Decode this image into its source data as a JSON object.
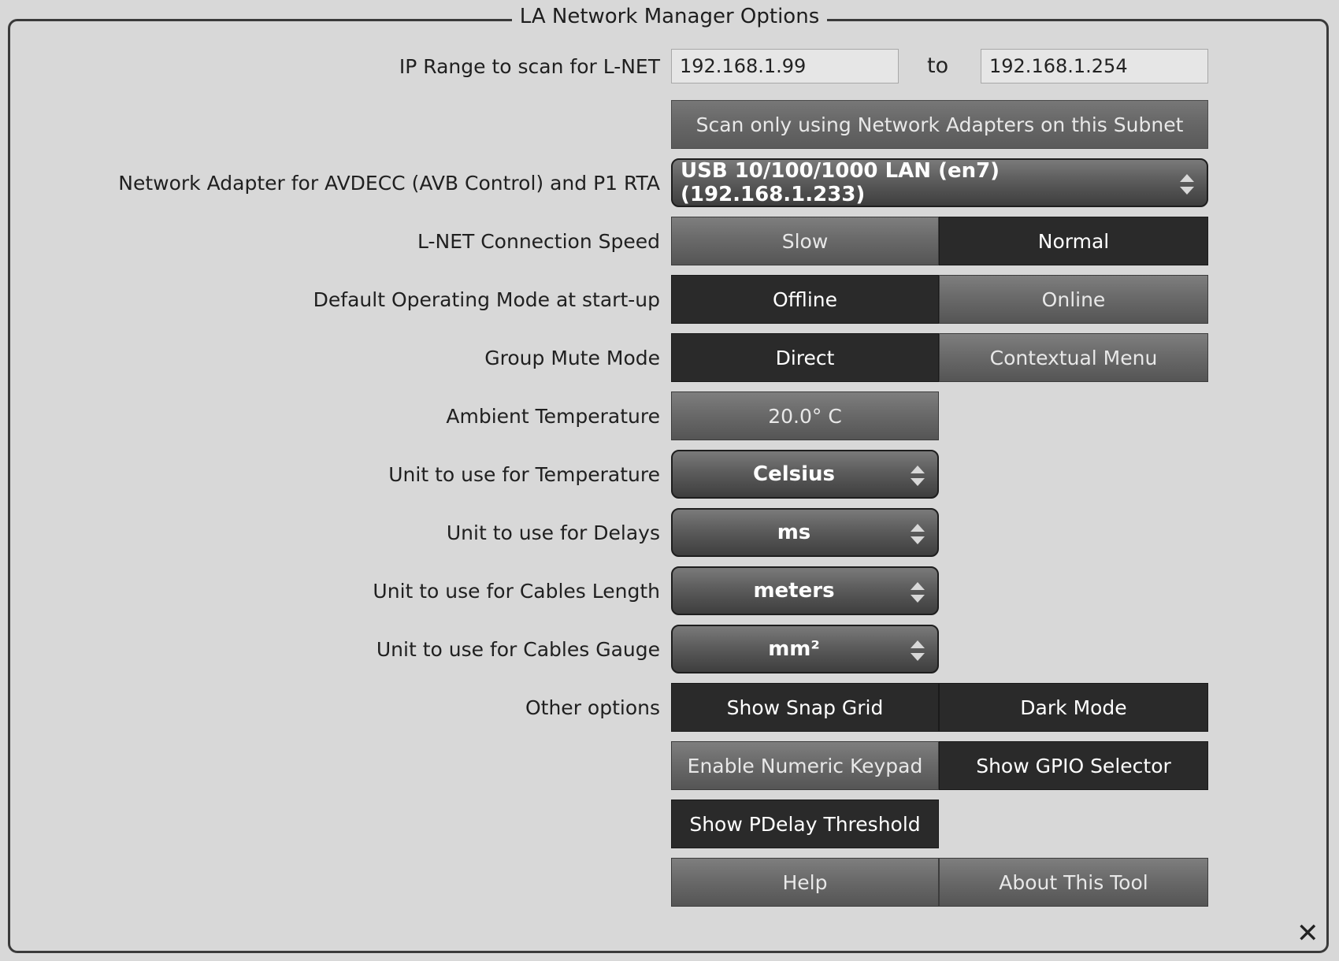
{
  "window": {
    "title": "LA Network Manager Options"
  },
  "ip_range": {
    "label": "IP Range to scan for L-NET",
    "from": "192.168.1.99",
    "to_label": "to",
    "to": "192.168.1.254",
    "subnet_button": "Scan only using Network Adapters on this Subnet"
  },
  "network_adapter": {
    "label": "Network Adapter for AVDECC (AVB Control) and P1 RTA",
    "value": "USB 10/100/1000 LAN (en7) (192.168.1.233)"
  },
  "connection_speed": {
    "label": "L-NET Connection Speed",
    "options": [
      "Slow",
      "Normal"
    ],
    "selected": "Normal"
  },
  "operating_mode": {
    "label": "Default Operating Mode at start-up",
    "options": [
      "Offline",
      "Online"
    ],
    "selected": "Offline"
  },
  "group_mute": {
    "label": "Group Mute Mode",
    "options": [
      "Direct",
      "Contextual Menu"
    ],
    "selected": "Direct"
  },
  "ambient_temperature": {
    "label": "Ambient Temperature",
    "value": "20.0° C"
  },
  "temperature_unit": {
    "label": "Unit to use for Temperature",
    "value": "Celsius"
  },
  "delay_unit": {
    "label": "Unit to use for Delays",
    "value": "ms"
  },
  "cable_length_unit": {
    "label": "Unit to use for Cables Length",
    "value": "meters"
  },
  "cable_gauge_unit": {
    "label": "Unit to use for Cables Gauge",
    "value": "mm²"
  },
  "other_options": {
    "label": "Other options",
    "show_snap_grid": "Show Snap Grid",
    "dark_mode": "Dark Mode",
    "enable_numeric_keypad": "Enable Numeric Keypad",
    "show_gpio_selector": "Show GPIO Selector",
    "show_pdelay_threshold": "Show PDelay Threshold"
  },
  "footer": {
    "help": "Help",
    "about": "About This Tool",
    "close_icon": "close-icon"
  }
}
